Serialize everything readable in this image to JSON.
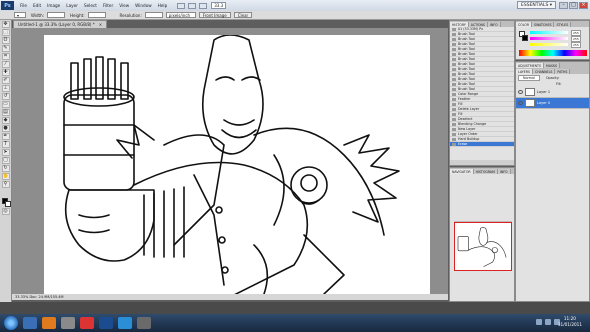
{
  "app": {
    "logo": "Ps",
    "menu": [
      "File",
      "Edit",
      "Image",
      "Layer",
      "Select",
      "Filter",
      "View",
      "Window",
      "Help"
    ],
    "zoom": "33.3",
    "workspace": "ESSENTIALS ▾"
  },
  "options": {
    "field1": "▾",
    "width_label": "Width:",
    "height_label": "Height:",
    "resolution_label": "Resolution:",
    "resolution_unit": "pixels/inch",
    "front_image": "Front Image",
    "clear": "Clear"
  },
  "document": {
    "tab_title": "Untitled-1 @ 33.3% (Layer 0, RGB/8) *",
    "status": "33.33%  Doc: 24.9M/155.4M"
  },
  "panels": {
    "history_tabs": [
      "HISTORY",
      "ACTIONS",
      "INFO"
    ],
    "history_items": [
      "01 (33.33M) Px",
      "Brush Tool",
      "Brush Tool",
      "Brush Tool",
      "Brush Tool",
      "Brush Tool",
      "Brush Tool",
      "Brush Tool",
      "Brush Tool",
      "Brush Tool",
      "Brush Tool",
      "Brush Tool",
      "Brush Tool",
      "Color Range",
      "Feather",
      "Fill",
      "Delete Layer",
      "Fill",
      "Deselect",
      "Blending Change",
      "New Layer",
      "Layer Order",
      "Hard Buildup",
      "Erase"
    ],
    "navigator_tabs": [
      "NAVIGATOR",
      "HISTOGRAM",
      "INFO"
    ],
    "color_tabs": [
      "COLOR",
      "SWATCHES",
      "STYLES"
    ],
    "color_values": [
      "255",
      "255",
      "255"
    ],
    "adjust_tabs": [
      "ADJUSTMENTS",
      "MASKS"
    ],
    "layers_tabs": [
      "LAYERS",
      "CHANNELS",
      "PATHS"
    ],
    "blend_mode": "Normal",
    "opacity_label": "Opacity:",
    "fill_label": "Fill:",
    "layers": [
      "Layer 1",
      "Layer 0"
    ]
  },
  "taskbar": {
    "time": "11:20",
    "date": "31/01/2011"
  },
  "colors": {
    "selection": "#3b78d6",
    "panel_bg": "#e2e2e2",
    "canvas_bg": "#8d8d8d"
  }
}
